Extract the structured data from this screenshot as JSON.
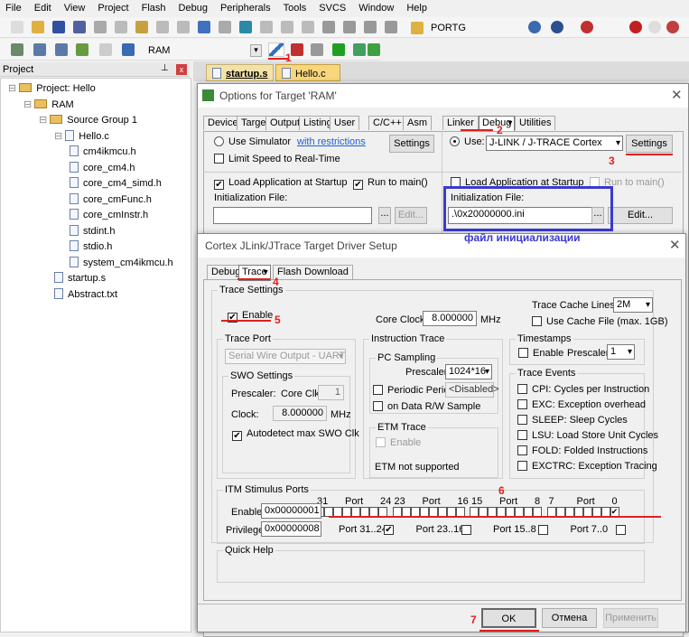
{
  "menu": [
    "File",
    "Edit",
    "View",
    "Project",
    "Flash",
    "Debug",
    "Peripherals",
    "Tools",
    "SVCS",
    "Window",
    "Help"
  ],
  "toolbar": {
    "search_value": "PORTG",
    "target_select": "RAM"
  },
  "project_panel": {
    "title": "Project",
    "tree": [
      {
        "label": "Project: Hello",
        "level": 0,
        "type": "project"
      },
      {
        "label": "RAM",
        "level": 1,
        "type": "folder"
      },
      {
        "label": "Source Group 1",
        "level": 2,
        "type": "folder"
      },
      {
        "label": "Hello.c",
        "level": 3,
        "type": "file"
      },
      {
        "label": "cm4ikmcu.h",
        "level": 4,
        "type": "file"
      },
      {
        "label": "core_cm4.h",
        "level": 4,
        "type": "file"
      },
      {
        "label": "core_cm4_simd.h",
        "level": 4,
        "type": "file"
      },
      {
        "label": "core_cmFunc.h",
        "level": 4,
        "type": "file"
      },
      {
        "label": "core_cmInstr.h",
        "level": 4,
        "type": "file"
      },
      {
        "label": "stdint.h",
        "level": 4,
        "type": "file"
      },
      {
        "label": "stdio.h",
        "level": 4,
        "type": "file"
      },
      {
        "label": "system_cm4ikmcu.h",
        "level": 4,
        "type": "file"
      },
      {
        "label": "startup.s",
        "level": 3,
        "type": "file"
      },
      {
        "label": "Abstract.txt",
        "level": 3,
        "type": "file"
      }
    ]
  },
  "editor_tabs": [
    "startup.s",
    "Hello.c"
  ],
  "options_dialog": {
    "title": "Options for Target 'RAM'",
    "tabs": [
      "Device",
      "Target",
      "Output",
      "Listing",
      "User",
      "C/C++",
      "Asm",
      "Linker",
      "Debug",
      "Utilities"
    ],
    "use_simulator": "Use Simulator",
    "with_restrictions": "with restrictions",
    "settings": "Settings",
    "limit_speed": "Limit Speed to Real-Time",
    "load_app": "Load Application at Startup",
    "run_to_main": "Run to main()",
    "init_file": "Initialization File:",
    "browse": "...",
    "edit": "Edit...",
    "use": "Use:",
    "driver": "J-LINK / J-TRACE Cortex",
    "init_file_value": ".\\0x20000000.ini",
    "annotation": "файл инициализации"
  },
  "driver_dialog": {
    "title": "Cortex JLink/JTrace Target Driver Setup",
    "tabs": [
      "Debug",
      "Trace",
      "Flash Download"
    ],
    "trace_settings": "Trace Settings",
    "enable": "Enable",
    "core_clock_label": "Core Clock:",
    "core_clock": "8.000000",
    "mhz": "MHz",
    "trace_cache_lines": "Trace Cache Lines",
    "cache_value": "2M",
    "use_cache_file": "Use Cache File (max. 1GB)",
    "trace_port": "Trace Port",
    "trace_port_value": "Serial Wire Output - UART/N",
    "swo_settings": "SWO Settings",
    "prescaler": "Prescaler:",
    "core_clk": "Core Clk /",
    "swo_prescaler": "1",
    "clock": "Clock:",
    "swo_clock": "8.000000",
    "autodetect": "Autodetect max SWO Clk",
    "instruction_trace": "Instruction Trace",
    "pc_sampling": "PC Sampling",
    "pc_prescaler": "1024*16",
    "periodic_period": "Periodic Period:",
    "disabled": "<Disabled>",
    "on_data_rw": "on Data R/W Sample",
    "etm_trace": "ETM Trace",
    "etm_not_supported": "ETM not supported",
    "timestamps": "Timestamps",
    "ts_prescaler": "1",
    "trace_events": "Trace Events",
    "events": [
      "CPI: Cycles per Instruction",
      "EXC: Exception overhead",
      "SLEEP: Sleep Cycles",
      "LSU: Load Store Unit Cycles",
      "FOLD: Folded Instructions",
      "EXCTRC: Exception Tracing"
    ],
    "itm": "ITM Stimulus Ports",
    "itm_enable_label": "Enable:",
    "itm_enable": "0x00000001",
    "privilege_label": "Privilege:",
    "privilege": "0x00000008",
    "port_headers": [
      [
        "31",
        "Port",
        "24"
      ],
      [
        "23",
        "Port",
        "16"
      ],
      [
        "15",
        "Port",
        "8"
      ],
      [
        "7",
        "Port",
        "0"
      ]
    ],
    "privilege_ports": [
      {
        "label": "Port 31..24",
        "checked": true
      },
      {
        "label": "Port 23..16",
        "checked": false
      },
      {
        "label": "Port 15..8",
        "checked": false
      },
      {
        "label": "Port 7..0",
        "checked": false
      }
    ],
    "enabled_ports": [
      0
    ],
    "quick_help": "Quick Help",
    "ok": "OK",
    "cancel": "Отмена",
    "apply": "Применить"
  },
  "annotations": [
    "1",
    "2",
    "3",
    "4",
    "5",
    "6",
    "7"
  ],
  "colors": {
    "annotation_red": "#e02020",
    "highlight_blue": "#3a3ad0"
  }
}
